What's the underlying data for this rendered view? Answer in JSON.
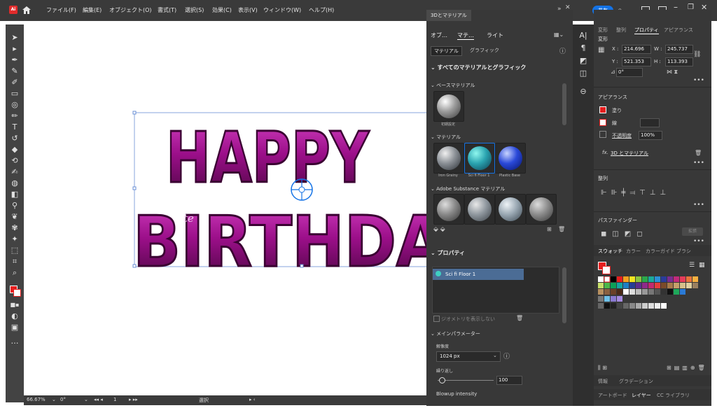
{
  "menubar": {
    "app_logo": "Ai",
    "items": [
      "ファイル(F)",
      "編集(E)",
      "オブジェクト(O)",
      "書式(T)",
      "選択(S)",
      "効果(C)",
      "表示(V)",
      "ウィンドウ(W)",
      "ヘルプ(H)"
    ],
    "share_label": "共有"
  },
  "canvas": {
    "line1": "HAPPY",
    "line2": "BIRTHDA",
    "overlay_text": "te"
  },
  "status": {
    "zoom": "66.67%",
    "rotation": "0°",
    "artboard": "1",
    "tool": "選択"
  },
  "panel3d": {
    "title": "3Dとマテリアル",
    "tabs": [
      "オブ…",
      "マテ…",
      "ライト"
    ],
    "subtabs": [
      "マテリアル",
      "グラフィック"
    ],
    "all_section": "すべてのマテリアルとグラフィック",
    "base_material": "ベースマテリアル",
    "base_caption": "初期設定",
    "materials_section": "マテリアル",
    "materials": [
      {
        "name": "Iron Grainy",
        "color1": "#d8dde0",
        "color2": "#3b4045"
      },
      {
        "name": "Sci fi Floor 1",
        "color1": "#4fe0d0",
        "color2": "#1a5f77"
      },
      {
        "name": "Plastic Base",
        "color1": "#7fa0ff",
        "color2": "#0a1a8a"
      }
    ],
    "substance_section": "Adobe Substance マテリアル",
    "properties_section": "プロパティ",
    "selected_item": "Sci fi Floor 1",
    "hide_geometry": "ジオメトリを表示しない",
    "main_params": "メインパラメーター",
    "resolution_label": "解像度",
    "resolution_value": "1024 px",
    "repeat_label": "繰り返し",
    "repeat_value": "100",
    "blowup_label": "Blowup intensity"
  },
  "right": {
    "tabs": [
      "変形",
      "整列",
      "プロパティ",
      "アピアランス"
    ],
    "transform_label": "変形",
    "x_label": "X :",
    "x_value": "214.696",
    "y_label": "Y :",
    "y_value": "521.353",
    "w_label": "W :",
    "w_value": "245.737",
    "h_label": "H :",
    "h_value": "113.393",
    "angle_value": "0°",
    "appearance_label": "アピアランス",
    "fill_label": "塗り",
    "stroke_label": "線",
    "opacity_label": "不透明度",
    "opacity_value": "100%",
    "fx_label": "3D とマテリアル",
    "align_label": "整列",
    "pathfinder_label": "パスファインダー",
    "expand_label": "拡張",
    "swatch_tabs": [
      "スウォッチ",
      "カラー",
      "カラーガイド",
      "ブラシ"
    ],
    "bottom_tabs1": [
      "情報",
      "グラデーション"
    ],
    "bottom_tabs2": [
      "アートボード",
      "レイヤー",
      "CC ライブラリ"
    ]
  },
  "colors": {
    "accent": "#1473e6",
    "letter_main": "#9c0f8a",
    "letter_dark": "#4a0540",
    "fill_red": "#e61e1e"
  }
}
